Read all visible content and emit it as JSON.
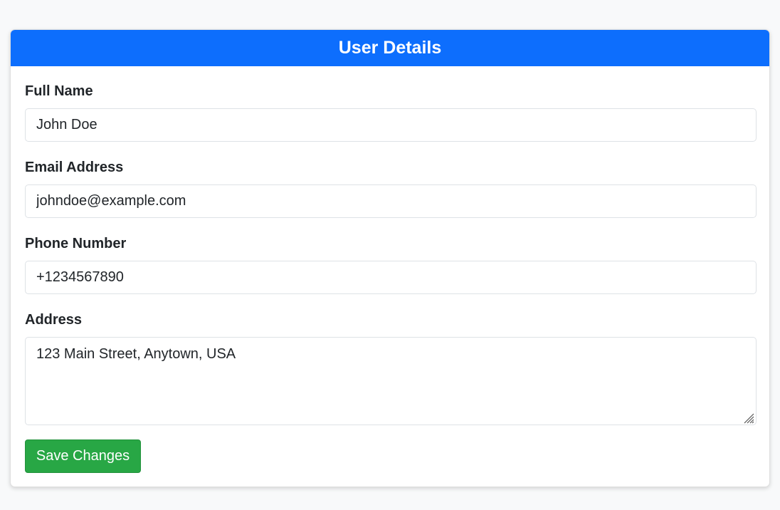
{
  "card": {
    "title": "User Details"
  },
  "form": {
    "full_name": {
      "label": "Full Name",
      "value": "John Doe"
    },
    "email": {
      "label": "Email Address",
      "value": "johndoe@example.com"
    },
    "phone": {
      "label": "Phone Number",
      "value": "+1234567890"
    },
    "address": {
      "label": "Address",
      "value": "123 Main Street, Anytown, USA"
    },
    "save_label": "Save Changes"
  },
  "colors": {
    "header_bg": "#0d6efd",
    "save_button_bg": "#28a745",
    "page_bg": "#f8f9fa"
  },
  "icons": {
    "textarea_resize": "resize-grip-icon"
  }
}
